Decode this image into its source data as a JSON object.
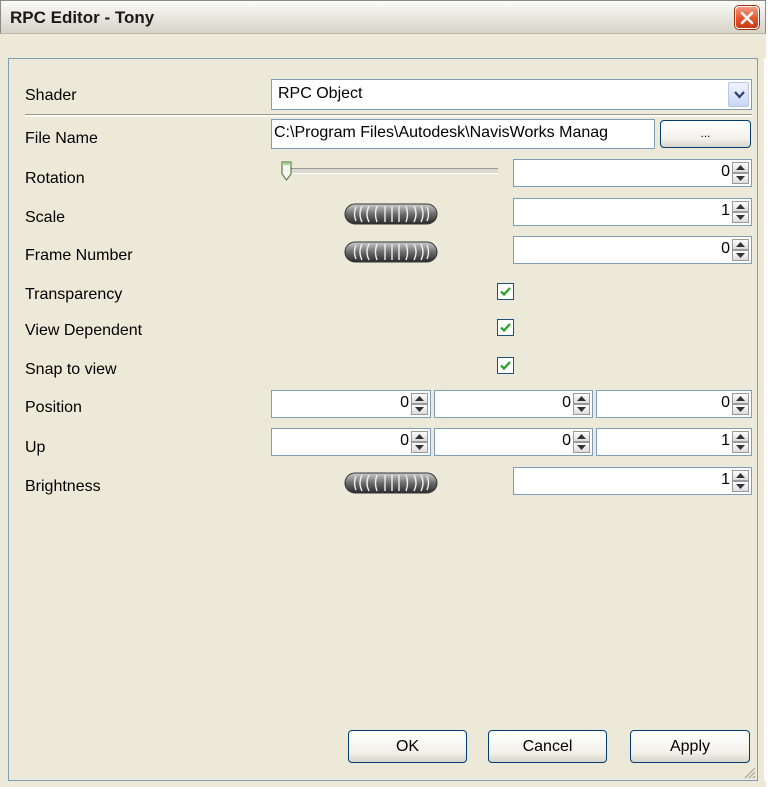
{
  "window": {
    "title": "RPC Editor - Tony"
  },
  "labels": {
    "shader": "Shader",
    "file_name": "File Name",
    "rotation": "Rotation",
    "scale": "Scale",
    "frame_number": "Frame Number",
    "transparency": "Transparency",
    "view_dependent": "View Dependent",
    "snap_to_view": "Snap to view",
    "position": "Position",
    "up": "Up",
    "brightness": "Brightness"
  },
  "fields": {
    "shader": "RPC Object",
    "file_name": "C:\\Program Files\\Autodesk\\NavisWorks Manag",
    "browse_label": "...",
    "rotation": "0",
    "rotation_slider_fraction": 0,
    "scale": "1",
    "frame_number": "0",
    "transparency": true,
    "view_dependent": true,
    "snap_to_view": true,
    "position": [
      "0",
      "0",
      "0"
    ],
    "up": [
      "0",
      "0",
      "1"
    ],
    "brightness": "1"
  },
  "buttons": {
    "ok": "OK",
    "cancel": "Cancel",
    "apply": "Apply"
  },
  "colors": {
    "close_button": "#e2542d",
    "checkmark": "#21a121",
    "input_border": "#7f9db9",
    "dialog_bg": "#ece9d8"
  },
  "icons": {
    "close": "close-icon",
    "dropdown": "chevron-down-icon",
    "check": "check-icon",
    "spin": "spin-arrows-icon",
    "jog": "jog-wheel-icon",
    "grip": "resize-grip-icon"
  }
}
